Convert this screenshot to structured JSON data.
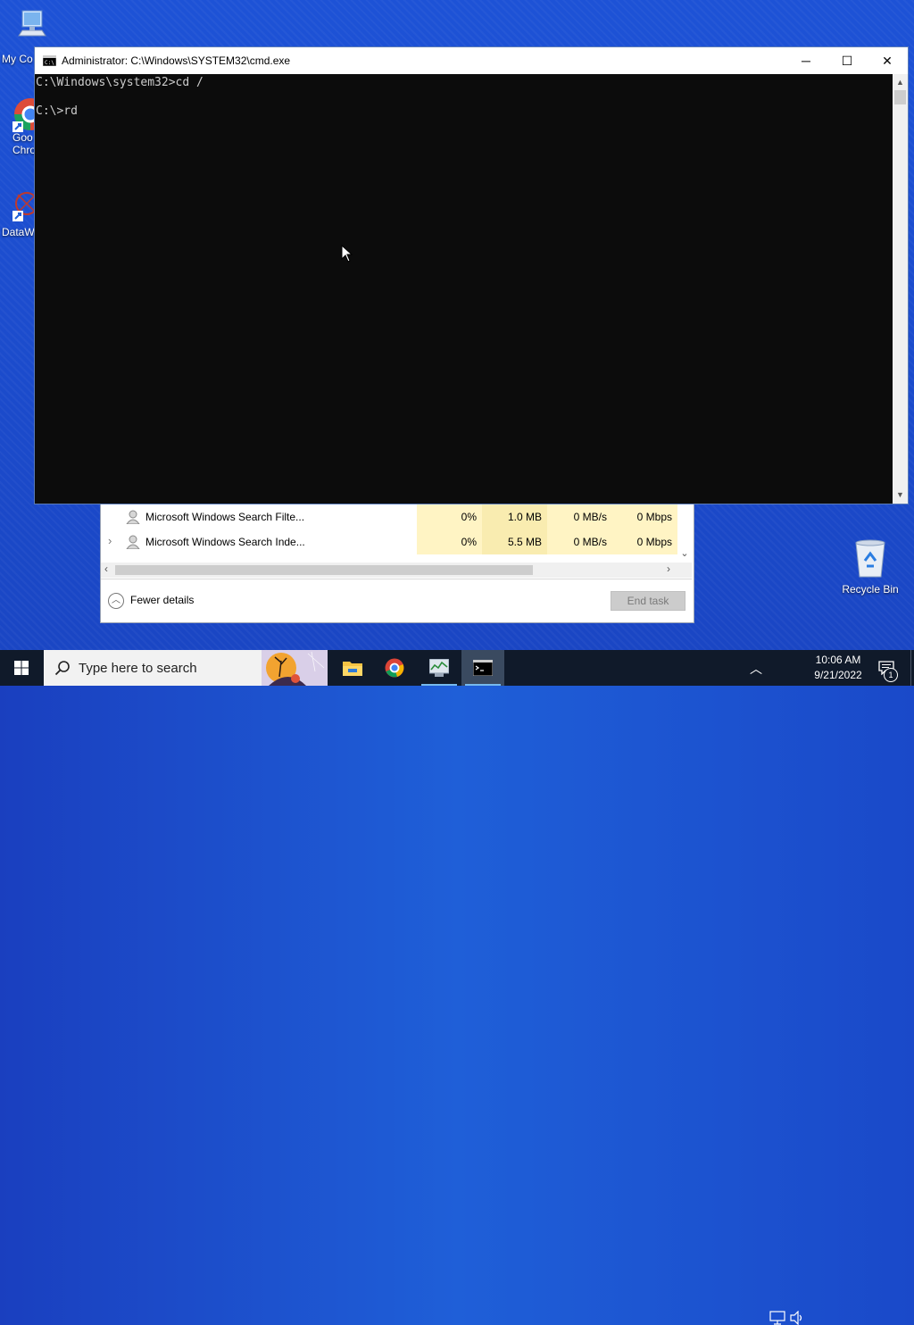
{
  "desktop": {
    "icons": [
      {
        "label": "My Co",
        "icon": "computer-icon"
      },
      {
        "label": "Goo\nChro",
        "icon": "chrome-shortcut-icon"
      },
      {
        "label": "DataW",
        "icon": "datawrapper-shortcut-icon"
      },
      {
        "label": "Recycle Bin",
        "icon": "recycle-bin-icon"
      }
    ]
  },
  "cmd": {
    "title": "Administrator: C:\\Windows\\SYSTEM32\\cmd.exe",
    "lines": [
      "C:\\Windows\\system32>cd /",
      "",
      "C:\\>rd"
    ],
    "minimize": "─",
    "maximize": "☐",
    "close": "✕"
  },
  "taskmgr": {
    "rows": [
      {
        "name": "Microsoft Windows Search Filte...",
        "cpu": "0%",
        "memory": "1.0 MB",
        "disk": "0 MB/s",
        "network": "0 Mbps",
        "expandable": false
      },
      {
        "name": "Microsoft Windows Search Inde...",
        "cpu": "0%",
        "memory": "5.5 MB",
        "disk": "0 MB/s",
        "network": "0 Mbps",
        "expandable": true
      }
    ],
    "fewer_details": "Fewer details",
    "end_task": "End task"
  },
  "taskbar": {
    "search_placeholder": "Type here to search",
    "time": "10:06 AM",
    "date": "9/21/2022",
    "notification_count": "1"
  }
}
